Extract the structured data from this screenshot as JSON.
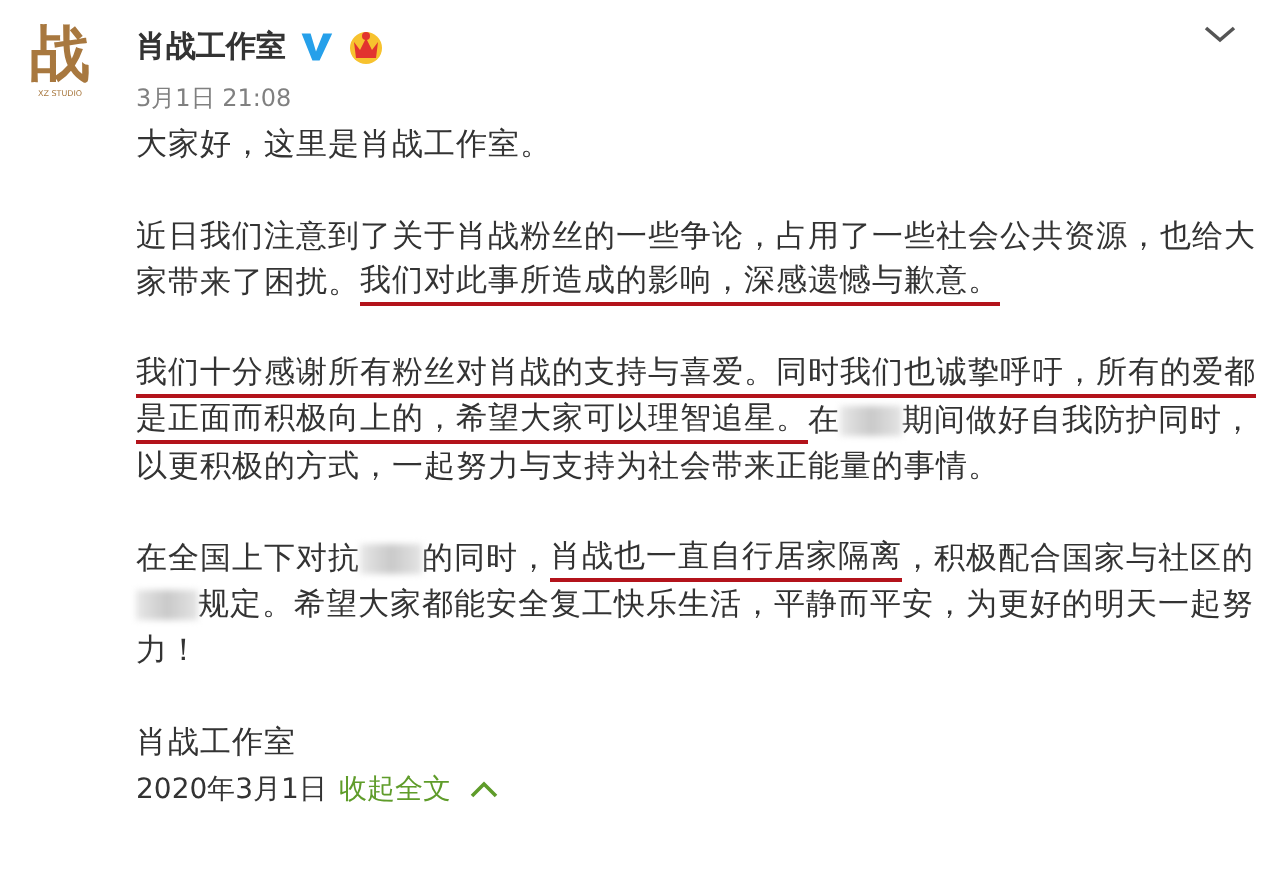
{
  "post": {
    "avatar": {
      "glyph": "战",
      "caption": "XZ STUDIO"
    },
    "author": "肖战工作室",
    "verified": true,
    "crown": true,
    "time": "3月1日 21:08",
    "paragraphs": [
      {
        "lines": [
          [
            {
              "kind": "text",
              "text": "大家好，这里是肖战工作室。",
              "underlined": false
            }
          ]
        ]
      },
      {
        "lines": [
          [
            {
              "kind": "text",
              "text": "近日我们注意到了关于肖战粉丝的一些争论，占用了一些社会公共资源，也给大",
              "underlined": false
            }
          ],
          [
            {
              "kind": "text",
              "text": "家带来了困扰。",
              "underlined": false
            },
            {
              "kind": "text",
              "text": "我们对此事所造成的影响，深感遗憾与歉意。",
              "underlined": true
            }
          ]
        ]
      },
      {
        "lines": [
          [
            {
              "kind": "text",
              "text": "我们十分感谢所有粉丝对肖战的支持与喜爱。同时我们也诚挚呼吁，所有的爱都",
              "underlined": true
            }
          ],
          [
            {
              "kind": "text",
              "text": "是正面而积极向上的，希望大家可以理智追星。",
              "underlined": true
            },
            {
              "kind": "text",
              "text": "在",
              "underlined": false
            },
            {
              "kind": "redacted"
            },
            {
              "kind": "text",
              "text": "期间做好自我防护同时，",
              "underlined": false
            }
          ],
          [
            {
              "kind": "text",
              "text": "以更积极的方式，一起努力与支持为社会带来正能量的事情。",
              "underlined": false
            }
          ]
        ]
      },
      {
        "lines": [
          [
            {
              "kind": "text",
              "text": "在全国上下对抗",
              "underlined": false
            },
            {
              "kind": "redacted"
            },
            {
              "kind": "text",
              "text": "的同时，",
              "underlined": false
            },
            {
              "kind": "text",
              "text": "肖战也一直自行居家隔离",
              "underlined": true
            },
            {
              "kind": "text",
              "text": "，积极配合国家与社区的",
              "underlined": false
            }
          ],
          [
            {
              "kind": "redacted"
            },
            {
              "kind": "text",
              "text": "规定。希望大家都能安全复工快乐生活，平静而平安，为更好的明天一起努",
              "underlined": false
            }
          ],
          [
            {
              "kind": "text",
              "text": "力！",
              "underlined": false
            }
          ]
        ]
      },
      {
        "lines": [
          [
            {
              "kind": "text",
              "text": "肖战工作室",
              "underlined": false
            }
          ]
        ]
      }
    ],
    "date": "2020年3月1日",
    "collapse_link": "收起全文"
  }
}
